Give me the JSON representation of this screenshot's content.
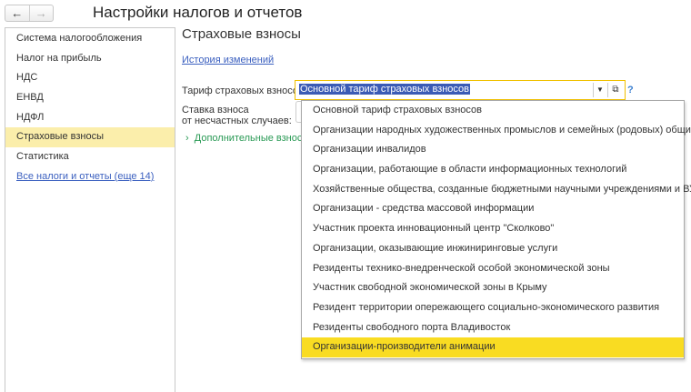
{
  "window": {
    "title": "Настройки налогов и отчетов",
    "back_icon": "←",
    "forward_icon": "→"
  },
  "sidebar": {
    "items": [
      {
        "label": "Система налогообложения"
      },
      {
        "label": "Налог на прибыль"
      },
      {
        "label": "НДС"
      },
      {
        "label": "ЕНВД"
      },
      {
        "label": "НДФЛ"
      },
      {
        "label": "Страховые взносы",
        "selected": true
      },
      {
        "label": "Статистика"
      },
      {
        "label": "Все налоги и отчеты (еще 14)",
        "link": true
      }
    ]
  },
  "main": {
    "heading": "Страховые взносы",
    "history_link": "История изменений",
    "tariff_label": "Тариф страховых взносов:",
    "tariff_value": "Основной тариф страховых взносов",
    "rate_label_1": "Ставка взноса",
    "rate_label_2": "от несчастных случаев:",
    "extra_section": "Дополнительные взносы",
    "help": "?"
  },
  "dropdown": {
    "items": [
      "Основной тариф страховых взносов",
      "Организации народных художественных промыслов и семейных (родовых) общин",
      "Организации инвалидов",
      "Организации, работающие в области информационных технологий",
      "Хозяйственные общества, созданные бюджетными научными учреждениями и ВУЗами",
      "Организации - средства массовой информации",
      "Участник проекта инновационный центр \"Сколково\"",
      "Организации, оказывающие инжиниринговые услуги",
      "Резиденты технико-внедренческой особой экономической зоны",
      "Участник свободной экономической зоны в Крыму",
      "Резидент территории опережающего социально-экономического развития",
      "Резиденты свободного порта Владивосток",
      "Организации-производители анимации"
    ],
    "highlighted": "Организации-производители анимации"
  },
  "colors": {
    "selected": "#fbeeab",
    "highlight": "#f9dc22",
    "link": "#3a5fbf",
    "accent_green": "#2a9a55"
  }
}
